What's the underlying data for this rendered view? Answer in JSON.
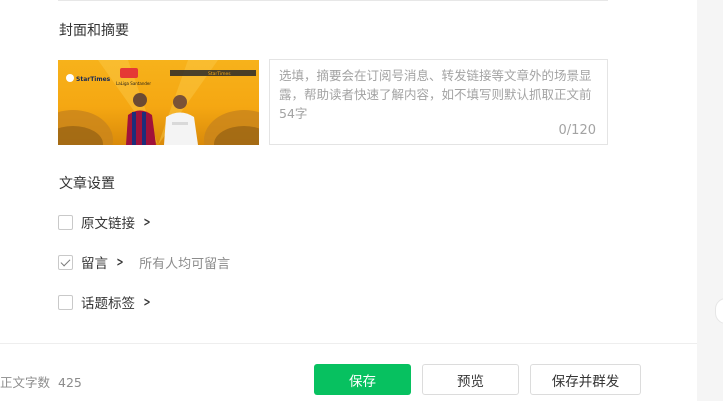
{
  "cover_section": {
    "title": "封面和摘要",
    "image": {
      "brand_left": "StarTimes",
      "brand_league": "LaLiga Santander",
      "brand_right": "StarTimes",
      "players": [
        "FC Barcelona player",
        "Real Madrid player"
      ]
    },
    "digest": {
      "placeholder": "选填，摘要会在订阅号消息、转发链接等文章外的场景显露，帮助读者快速了解内容，如不填写则默认抓取正文前54字",
      "counter": "0/120"
    }
  },
  "settings_section": {
    "title": "文章设置",
    "options": [
      {
        "label": "原文链接",
        "checked": false
      },
      {
        "label": "留言",
        "checked": true,
        "hint": "所有人均可留言"
      },
      {
        "label": "话题标签",
        "checked": false
      }
    ]
  },
  "footer": {
    "word_count_label": "正文字数",
    "word_count": "425",
    "save_label": "保存",
    "preview_label": "预览",
    "publish_label": "保存并群发"
  },
  "colors": {
    "primary": "#07c160",
    "cover_background": "#f5a712"
  }
}
